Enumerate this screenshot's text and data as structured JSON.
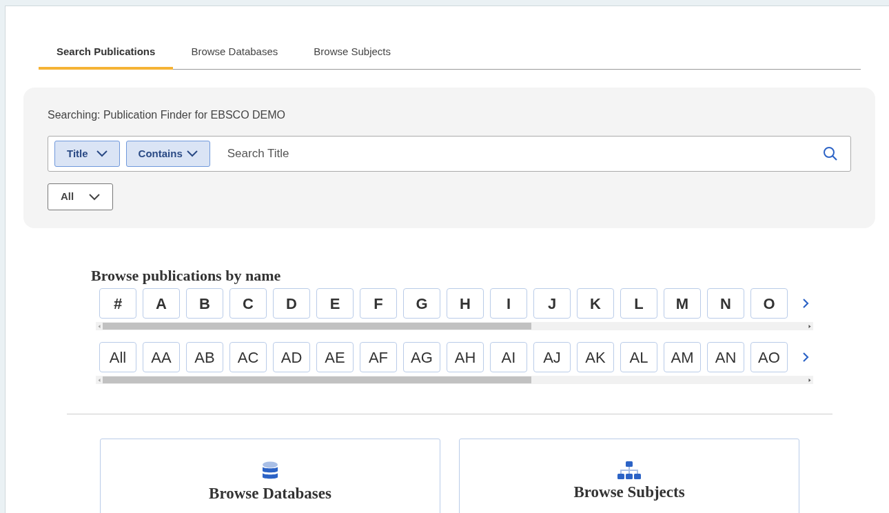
{
  "tabs": [
    {
      "label": "Search Publications",
      "selected": true
    },
    {
      "label": "Browse Databases",
      "selected": false
    },
    {
      "label": "Browse Subjects",
      "selected": false
    }
  ],
  "search": {
    "scope": "Searching: Publication Finder for EBSCO DEMO",
    "field_dropdown": "Title",
    "match_dropdown": "Contains",
    "placeholder": "Search Title",
    "filter_dropdown": "All"
  },
  "browse": {
    "heading": "Browse publications by name",
    "letters": [
      "#",
      "A",
      "B",
      "C",
      "D",
      "E",
      "F",
      "G",
      "H",
      "I",
      "J",
      "K",
      "L",
      "M",
      "N",
      "O"
    ],
    "prefixes": [
      "All",
      "AA",
      "AB",
      "AC",
      "AD",
      "AE",
      "AF",
      "AG",
      "AH",
      "AI",
      "AJ",
      "AK",
      "AL",
      "AM",
      "AN",
      "AO"
    ]
  },
  "cards": [
    {
      "kind": "database",
      "title": "Browse Databases"
    },
    {
      "kind": "subjects",
      "title": "Browse Subjects"
    }
  ]
}
